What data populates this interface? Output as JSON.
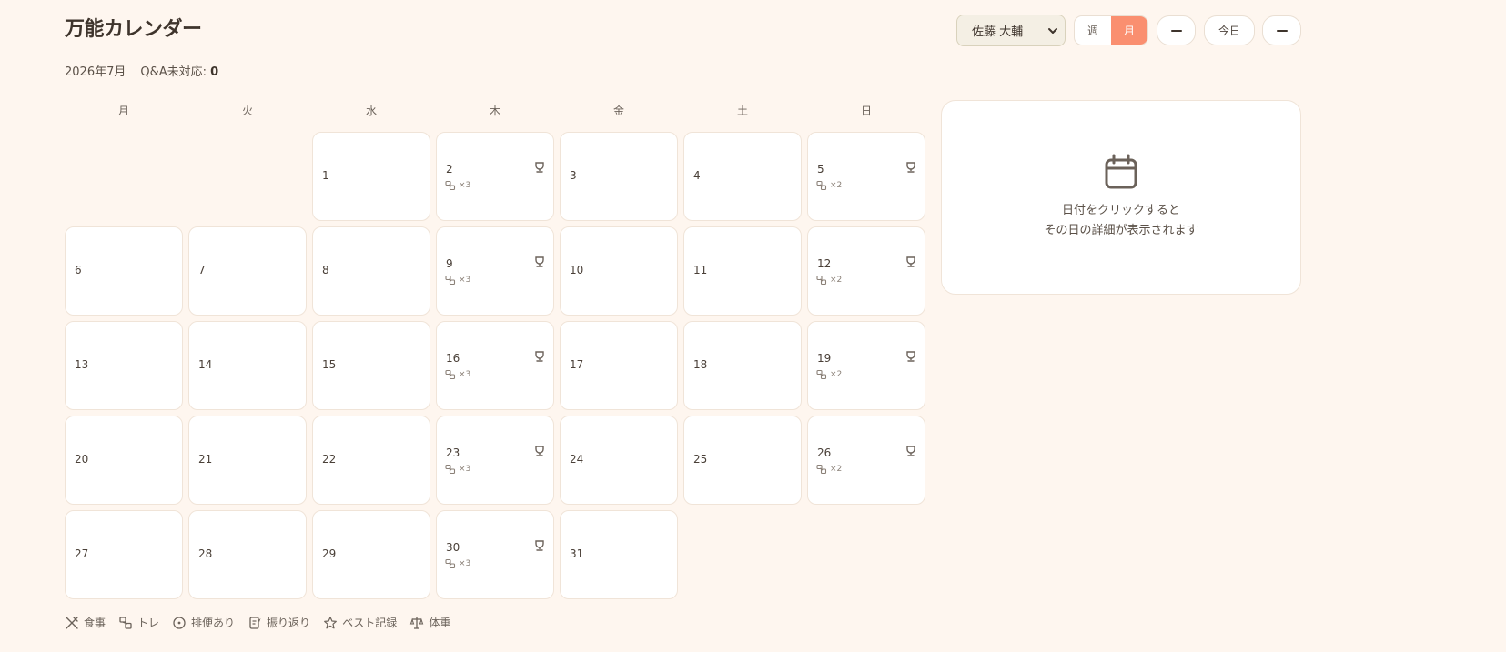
{
  "header": {
    "title": "万能カレンダー",
    "month_label": "2026年7月",
    "qa_label": "Q&A未対応:",
    "qa_count": "0"
  },
  "toolbar": {
    "user_selected": "佐藤 大輔",
    "view_week": "週",
    "view_month": "月",
    "active_view": "month",
    "prev_icon": "minus-icon",
    "today_label": "今日",
    "next_icon": "minus-icon",
    "accent_color": "#FA8F70"
  },
  "calendar": {
    "weekdays": [
      "月",
      "火",
      "水",
      "木",
      "金",
      "土",
      "日"
    ],
    "first_weekday_index": 2,
    "days_in_month": 31,
    "days": [
      {
        "day": "1"
      },
      {
        "day": "2",
        "training": "×3",
        "best": true
      },
      {
        "day": "3"
      },
      {
        "day": "4"
      },
      {
        "day": "5",
        "training": "×2",
        "best": true
      },
      {
        "day": "6"
      },
      {
        "day": "7"
      },
      {
        "day": "8"
      },
      {
        "day": "9",
        "training": "×3",
        "best": true
      },
      {
        "day": "10"
      },
      {
        "day": "11"
      },
      {
        "day": "12",
        "training": "×2",
        "best": true
      },
      {
        "day": "13"
      },
      {
        "day": "14"
      },
      {
        "day": "15"
      },
      {
        "day": "16",
        "training": "×3",
        "best": true
      },
      {
        "day": "17"
      },
      {
        "day": "18"
      },
      {
        "day": "19",
        "training": "×2",
        "best": true
      },
      {
        "day": "20"
      },
      {
        "day": "21"
      },
      {
        "day": "22"
      },
      {
        "day": "23",
        "training": "×3",
        "best": true
      },
      {
        "day": "24"
      },
      {
        "day": "25"
      },
      {
        "day": "26",
        "training": "×2",
        "best": true
      },
      {
        "day": "27"
      },
      {
        "day": "28"
      },
      {
        "day": "29"
      },
      {
        "day": "30",
        "training": "×3",
        "best": true
      },
      {
        "day": "31"
      }
    ]
  },
  "detail": {
    "icon": "calendar-icon",
    "hint_line1": "日付をクリックすると",
    "hint_line2": "その日の詳細が表示されます"
  },
  "legend": [
    {
      "icon": "meal-icon",
      "label": "食事"
    },
    {
      "icon": "training-icon",
      "label": "トレ"
    },
    {
      "icon": "bowel-icon",
      "label": "排便あり"
    },
    {
      "icon": "reflection-icon",
      "label": "振り返り"
    },
    {
      "icon": "star-icon",
      "label": "ベスト記録"
    },
    {
      "icon": "scale-icon",
      "label": "体重"
    }
  ]
}
